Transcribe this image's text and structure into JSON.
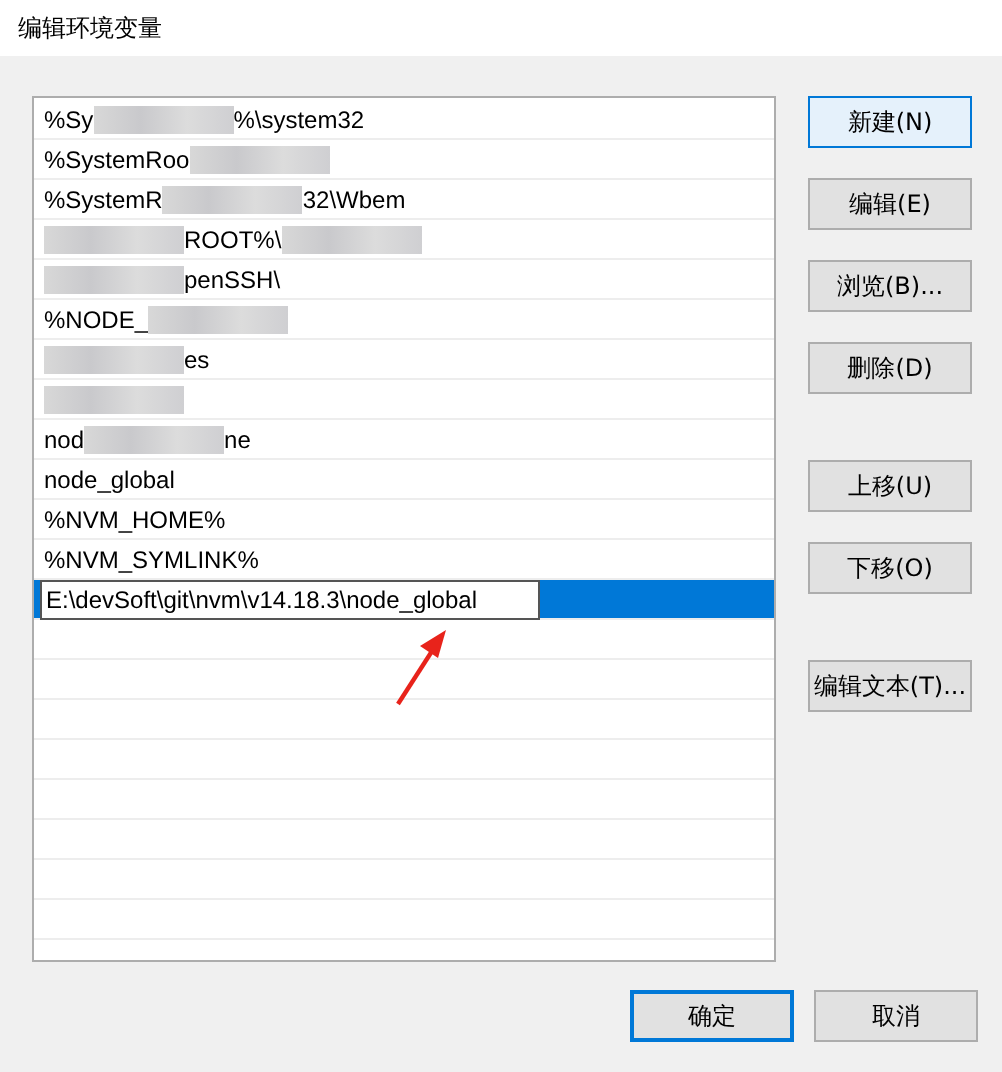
{
  "window": {
    "title": "编辑环境变量"
  },
  "list": {
    "rows": [
      {
        "selected": false,
        "segments": [
          {
            "kind": "text",
            "text": "%Sy"
          },
          {
            "kind": "redacted"
          },
          {
            "kind": "text",
            "text": "%\\system32"
          }
        ]
      },
      {
        "selected": false,
        "segments": [
          {
            "kind": "text",
            "text": "%SystemRoo"
          },
          {
            "kind": "redacted"
          }
        ]
      },
      {
        "selected": false,
        "segments": [
          {
            "kind": "text",
            "text": "%SystemR"
          },
          {
            "kind": "redacted"
          },
          {
            "kind": "text",
            "text": "32\\Wbem"
          }
        ]
      },
      {
        "selected": false,
        "segments": [
          {
            "kind": "redacted"
          },
          {
            "kind": "text",
            "text": "ROOT%\\"
          },
          {
            "kind": "redacted"
          }
        ]
      },
      {
        "selected": false,
        "segments": [
          {
            "kind": "redacted"
          },
          {
            "kind": "text",
            "text": "penSSH\\"
          }
        ]
      },
      {
        "selected": false,
        "segments": [
          {
            "kind": "text",
            "text": "%NODE_"
          },
          {
            "kind": "redacted"
          }
        ]
      },
      {
        "selected": false,
        "segments": [
          {
            "kind": "redacted"
          },
          {
            "kind": "text",
            "text": "es"
          }
        ]
      },
      {
        "selected": false,
        "segments": [
          {
            "kind": "redacted"
          }
        ]
      },
      {
        "selected": false,
        "segments": [
          {
            "kind": "text",
            "text": "nod"
          },
          {
            "kind": "redacted"
          },
          {
            "kind": "text",
            "text": "ne"
          }
        ]
      },
      {
        "selected": false,
        "segments": [
          {
            "kind": "text",
            "text": "node_global"
          }
        ]
      },
      {
        "selected": false,
        "segments": [
          {
            "kind": "text",
            "text": "%NVM_HOME%"
          }
        ]
      },
      {
        "selected": false,
        "segments": [
          {
            "kind": "text",
            "text": "%NVM_SYMLINK%"
          }
        ]
      },
      {
        "selected": true,
        "editing": true,
        "value": "E:\\devSoft\\git\\nvm\\v14.18.3\\node_global"
      }
    ]
  },
  "side_button_groups": [
    [
      {
        "label": "新建(N)",
        "focused": true
      },
      {
        "label": "编辑(E)",
        "focused": false
      },
      {
        "label": "浏览(B)...",
        "focused": false
      },
      {
        "label": "删除(D)",
        "focused": false
      }
    ],
    [
      {
        "label": "上移(U)",
        "focused": false
      },
      {
        "label": "下移(O)",
        "focused": false
      }
    ],
    [
      {
        "label": "编辑文本(T)...",
        "focused": false
      }
    ]
  ],
  "footer_buttons": [
    {
      "label": "确定",
      "default": true
    },
    {
      "label": "取消",
      "default": false
    }
  ]
}
